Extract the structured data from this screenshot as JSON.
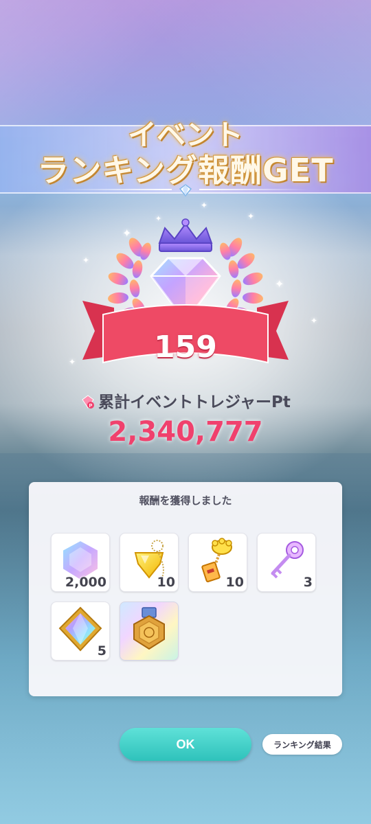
{
  "title": {
    "line1": "イベント",
    "line2": "ランキング報酬GET"
  },
  "rank": {
    "number": "159"
  },
  "points": {
    "label": "累計イベントトレジャーPt",
    "value": "2,340,777",
    "icon": "treasure-pt-icon"
  },
  "panel": {
    "heading": "報酬を獲得しました",
    "items": [
      {
        "icon": "rainbow-gem-icon",
        "quantity": "2,000"
      },
      {
        "icon": "yellow-heart-charm-icon",
        "quantity": "10"
      },
      {
        "icon": "glove-key-icon",
        "quantity": "10"
      },
      {
        "icon": "purple-key-icon",
        "quantity": "3"
      },
      {
        "icon": "rainbow-crystal-card-icon",
        "quantity": "5"
      },
      {
        "icon": "gold-medal-badge-icon",
        "quantity": ""
      }
    ]
  },
  "buttons": {
    "ok": "OK",
    "ranking_result": "ランキング結果"
  },
  "colors": {
    "accent_pink": "#f0416d",
    "ok_teal": "#2fc2bb",
    "ribbon_red": "#e8455f"
  }
}
